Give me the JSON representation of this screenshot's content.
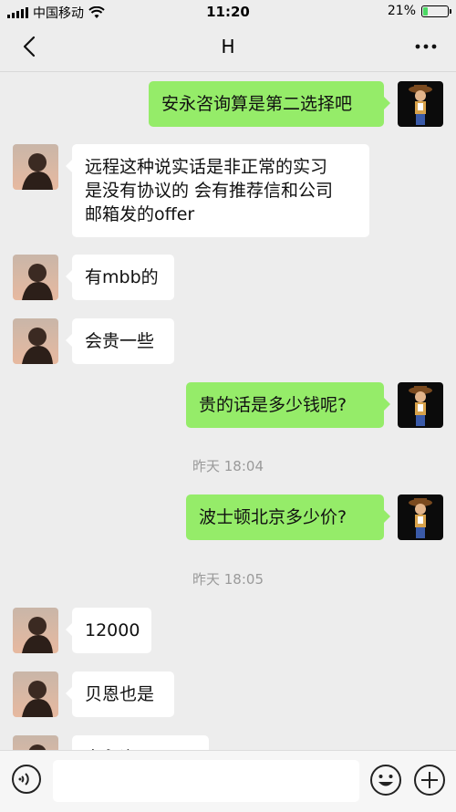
{
  "status_bar": {
    "carrier": "中国移动",
    "time": "11:20",
    "battery_text": "21%",
    "battery_level": 0.21,
    "battery_color": "#4cd964"
  },
  "nav": {
    "title": "H",
    "back_icon": "chevron-left-icon",
    "more_icon": "more-dots-icon"
  },
  "colors": {
    "outgoing_bubble": "#95ec69",
    "incoming_bubble": "#ffffff",
    "background": "#ededed"
  },
  "messages": [
    {
      "dir": "out",
      "text": "安永咨询算是第二选择吧"
    },
    {
      "dir": "in",
      "text": "远程这种说实话是非正常的实习\n是没有协议的 会有推荐信和公司\n邮箱发的offer"
    },
    {
      "dir": "in",
      "text": "有mbb的"
    },
    {
      "dir": "in",
      "text": "会贵一些"
    },
    {
      "dir": "out",
      "text": "贵的话是多少钱呢?"
    },
    {
      "type": "time",
      "text": "昨天 18:04"
    },
    {
      "dir": "out",
      "text": "波士顿北京多少价?"
    },
    {
      "type": "time",
      "text": "昨天 18:05"
    },
    {
      "dir": "in",
      "text": "12000"
    },
    {
      "dir": "in",
      "text": "贝恩也是"
    },
    {
      "dir": "in",
      "text": "安永咨"
    }
  ],
  "input_bar": {
    "voice_icon": "voice-icon",
    "emoji_icon": "emoji-icon",
    "plus_icon": "plus-icon",
    "placeholder": ""
  }
}
